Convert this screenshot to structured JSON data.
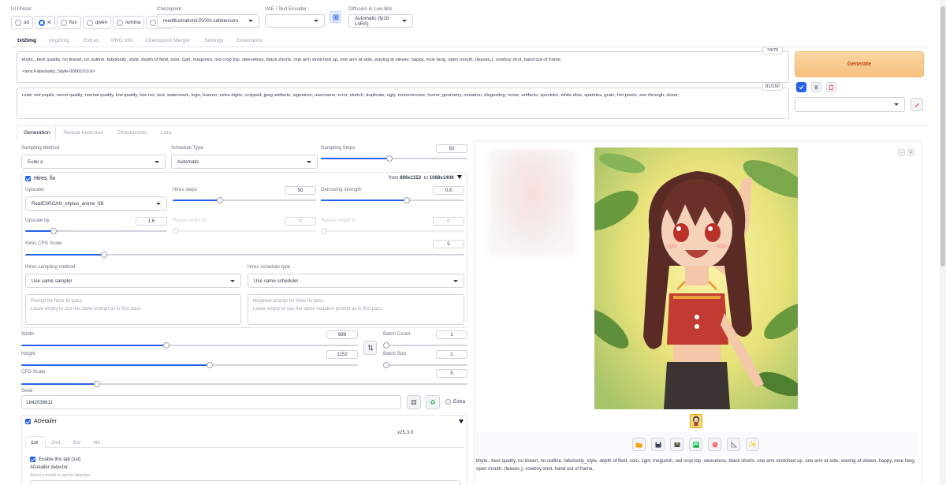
{
  "preset": {
    "label": "UI Preset",
    "options": [
      "sd",
      "xl",
      "flux",
      "qwen",
      "lumina",
      "wan"
    ],
    "selected": "xl"
  },
  "checkpoint": {
    "label": "Checkpoint",
    "value": "reedillustrationil.PVXH.safetensors"
  },
  "vae": {
    "label": "VAE / Text Encoder",
    "value": ""
  },
  "lowbits": {
    "label": "Diffusion in Low Bits",
    "value": "Automatic (fp16 LoRA)"
  },
  "main_tabs": [
    "txt2img",
    "Img2img",
    "Extras",
    "PNG Info",
    "Checkpoint Merger",
    "Settings",
    "Extensions"
  ],
  "prompt": {
    "line1": "khyle., best quality, no lineart, no outline, fabulosity_style, depth of field, solo, 1girl, megumin, red crop top, sleeveless, black shorts, one arm stretched up, one arm at side, waving at viewer, happy, moe fang, open mouth, (leaves,), cowboy shot, hand out of frame,",
    "line2": "<lora:Fabulosity_Style-000010:0.6>",
    "counter": "74/75"
  },
  "negative": {
    "text": "road, red pupils, worst quality, normal quality, low quality, low res,  text, watermark, logo, banner, extra digits, cropped, jpeg artifacts, signature, username, error, sketch, duplicate, ugly, monochrome, horror, geometry, mutation, disgusting, noise, artifacts, speckles, white dots, sparkles, grain, hot pixels, see through, sheer,",
    "counter": "81/150"
  },
  "generate_label": "Generate",
  "sub_tabs": [
    "Generation",
    "Textual Inversion",
    "Checkpoints",
    "Lora"
  ],
  "sampling": {
    "method_label": "Sampling Method",
    "method": "Euler a",
    "schedule_label": "Schedule Type",
    "schedule": "Automatic",
    "steps_label": "Sampling Steps",
    "steps": "50",
    "steps_frac": 0.47
  },
  "hires": {
    "label": "Hires. fix",
    "from_prefix": "from",
    "from": "896x1152",
    "to_prefix": "to",
    "to": "1088x1408",
    "upscaler_label": "Upscaler",
    "upscaler": "RealESRGAN_x4plus_anime_6B",
    "steps_label": "Hires steps",
    "steps": "50",
    "steps_frac": 0.33,
    "denoise_label": "Denoising strength",
    "denoise": "0.6",
    "denoise_frac": 0.6,
    "upscale_label": "Upscale by",
    "upscale": "1.6",
    "upscale_frac": 0.2,
    "rw_label": "Resize width to",
    "rw": "0",
    "rh_label": "Resize height to",
    "rh": "0",
    "cfg_label": "Hires CFG Scale",
    "cfg": "5",
    "cfg_frac": 0.18,
    "sampler_label": "Hires sampling method",
    "sampler": "Use same sampler",
    "scheduler_label": "Hires schedule type",
    "scheduler": "Use same scheduler",
    "prompt_ph1": "Prompt for hires fix pass.",
    "prompt_ph2": "Leave empty to use the same prompt as in first pass.",
    "neg_ph1": "Negative prompt for hires fix pass.",
    "neg_ph2": "Leave empty to use the same negative prompt as in first pass."
  },
  "size": {
    "width_label": "Width",
    "width": "896",
    "width_frac": 0.43,
    "height_label": "Height",
    "height": "1152",
    "height_frac": 0.56,
    "batch_count_label": "Batch Count",
    "batch_count": "1",
    "batch_size_label": "Batch Size",
    "batch_size": "1"
  },
  "cfg": {
    "label": "CFG Scale",
    "value": "5",
    "frac": 0.17
  },
  "seed": {
    "label": "Seed",
    "value": "1842036611",
    "extra_label": "Extra"
  },
  "adetailer": {
    "label": "ADetailer",
    "version": "v25.3.0",
    "tabs": [
      "1st",
      "2nd",
      "3rd",
      "4th"
    ],
    "enable_label": "Enable this tab (1st)",
    "detector_label": "ADetailer detector",
    "detector_hint": "Select a model to use for detection."
  },
  "output": {
    "caption": "khyle., best quality, no lineart, no outline, fabulosity_style, depth of field, solo, 1girl, megumin, red crop top, sleeveless, black shorts, one arm stretched up, one arm at side, waving at viewer, happy, moe fang, open mouth, (leaves,), cowboy shot, hand out of frame,"
  },
  "colors": {
    "accent": "#2563eb",
    "generate_bg": "#f8c98d",
    "generate_text": "#c2410c"
  }
}
